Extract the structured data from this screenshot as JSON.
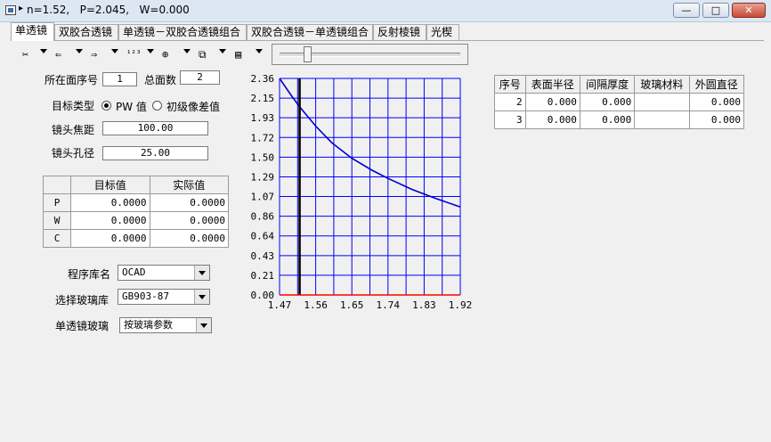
{
  "window": {
    "title": "n=1.52,   P=2.045,   W=0.000",
    "buttons": {
      "minimize": "—",
      "maximize": "□",
      "close": "✕"
    }
  },
  "tabs": [
    {
      "label": "单透镜",
      "active": true
    },
    {
      "label": "双胶合透镜"
    },
    {
      "label": "单透镜－双胶合透镜组合"
    },
    {
      "label": "双胶合透镜－单透镜组合"
    },
    {
      "label": "反射棱镜"
    },
    {
      "label": "光楔"
    }
  ],
  "toolbar": {
    "icons": [
      "scissors-icon",
      "insert-before-icon",
      "insert-after-icon",
      "sort-icon",
      "zoom-icon",
      "copy-icon",
      "paste-icon"
    ],
    "glyphs": [
      "✂",
      "⇐",
      "⇒",
      "¹²³",
      "⊕",
      "⧉",
      "▤"
    ]
  },
  "form": {
    "surface_no_label": "所在面序号",
    "surface_no_value": "1",
    "total_surfaces_label": "总面数",
    "total_surfaces_value": "2",
    "target_type_label": "目标类型",
    "radio_pw_label": "PW 值",
    "radio_aberration_label": "初级像差值",
    "focal_label": "镜头焦距",
    "focal_value": "100.00",
    "aperture_label": "镜头孔径",
    "aperture_value": "25.00",
    "library_label": "程序库名",
    "library_value": "OCAD",
    "glass_lib_label": "选择玻璃库",
    "glass_lib_value": "GB903-87",
    "single_glass_label": "单透镜玻璃",
    "single_glass_value": "按玻璃参数"
  },
  "pw_table": {
    "headers": [
      "目标值",
      "实际值"
    ],
    "rows": [
      {
        "name": "P",
        "target": "0.0000",
        "actual": "0.0000"
      },
      {
        "name": "W",
        "target": "0.0000",
        "actual": "0.0000"
      },
      {
        "name": "C",
        "target": "0.0000",
        "actual": "0.0000"
      }
    ]
  },
  "surface_table": {
    "headers": [
      "序号",
      "表面半径",
      "间隔厚度",
      "玻璃材料",
      "外圆直径"
    ],
    "rows": [
      [
        "2",
        "0.000",
        "0.000",
        "",
        "0.000"
      ],
      [
        "3",
        "0.000",
        "0.000",
        "",
        "0.000"
      ]
    ]
  },
  "chart_data": {
    "type": "line",
    "x_ticks": [
      "1.47",
      "1.56",
      "1.65",
      "1.74",
      "1.83",
      "1.92"
    ],
    "y_ticks": [
      "2.36",
      "2.15",
      "1.93",
      "1.72",
      "1.50",
      "1.29",
      "1.07",
      "0.86",
      "0.64",
      "0.43",
      "0.21",
      "0.00"
    ],
    "xlim": [
      1.47,
      1.92
    ],
    "ylim": [
      0.0,
      2.36
    ],
    "grid": true,
    "marker_x": 1.52,
    "series": [
      {
        "x": [
          1.47,
          1.5,
          1.52,
          1.56,
          1.6,
          1.65,
          1.7,
          1.74,
          1.8,
          1.86,
          1.92
        ],
        "y": [
          2.36,
          2.17,
          2.05,
          1.84,
          1.66,
          1.49,
          1.36,
          1.27,
          1.15,
          1.05,
          0.96
        ]
      }
    ],
    "colors": {
      "axes": "#0000ff",
      "curve": "#0000cc",
      "marker": "#000000",
      "baseline": "#ff0000"
    }
  }
}
